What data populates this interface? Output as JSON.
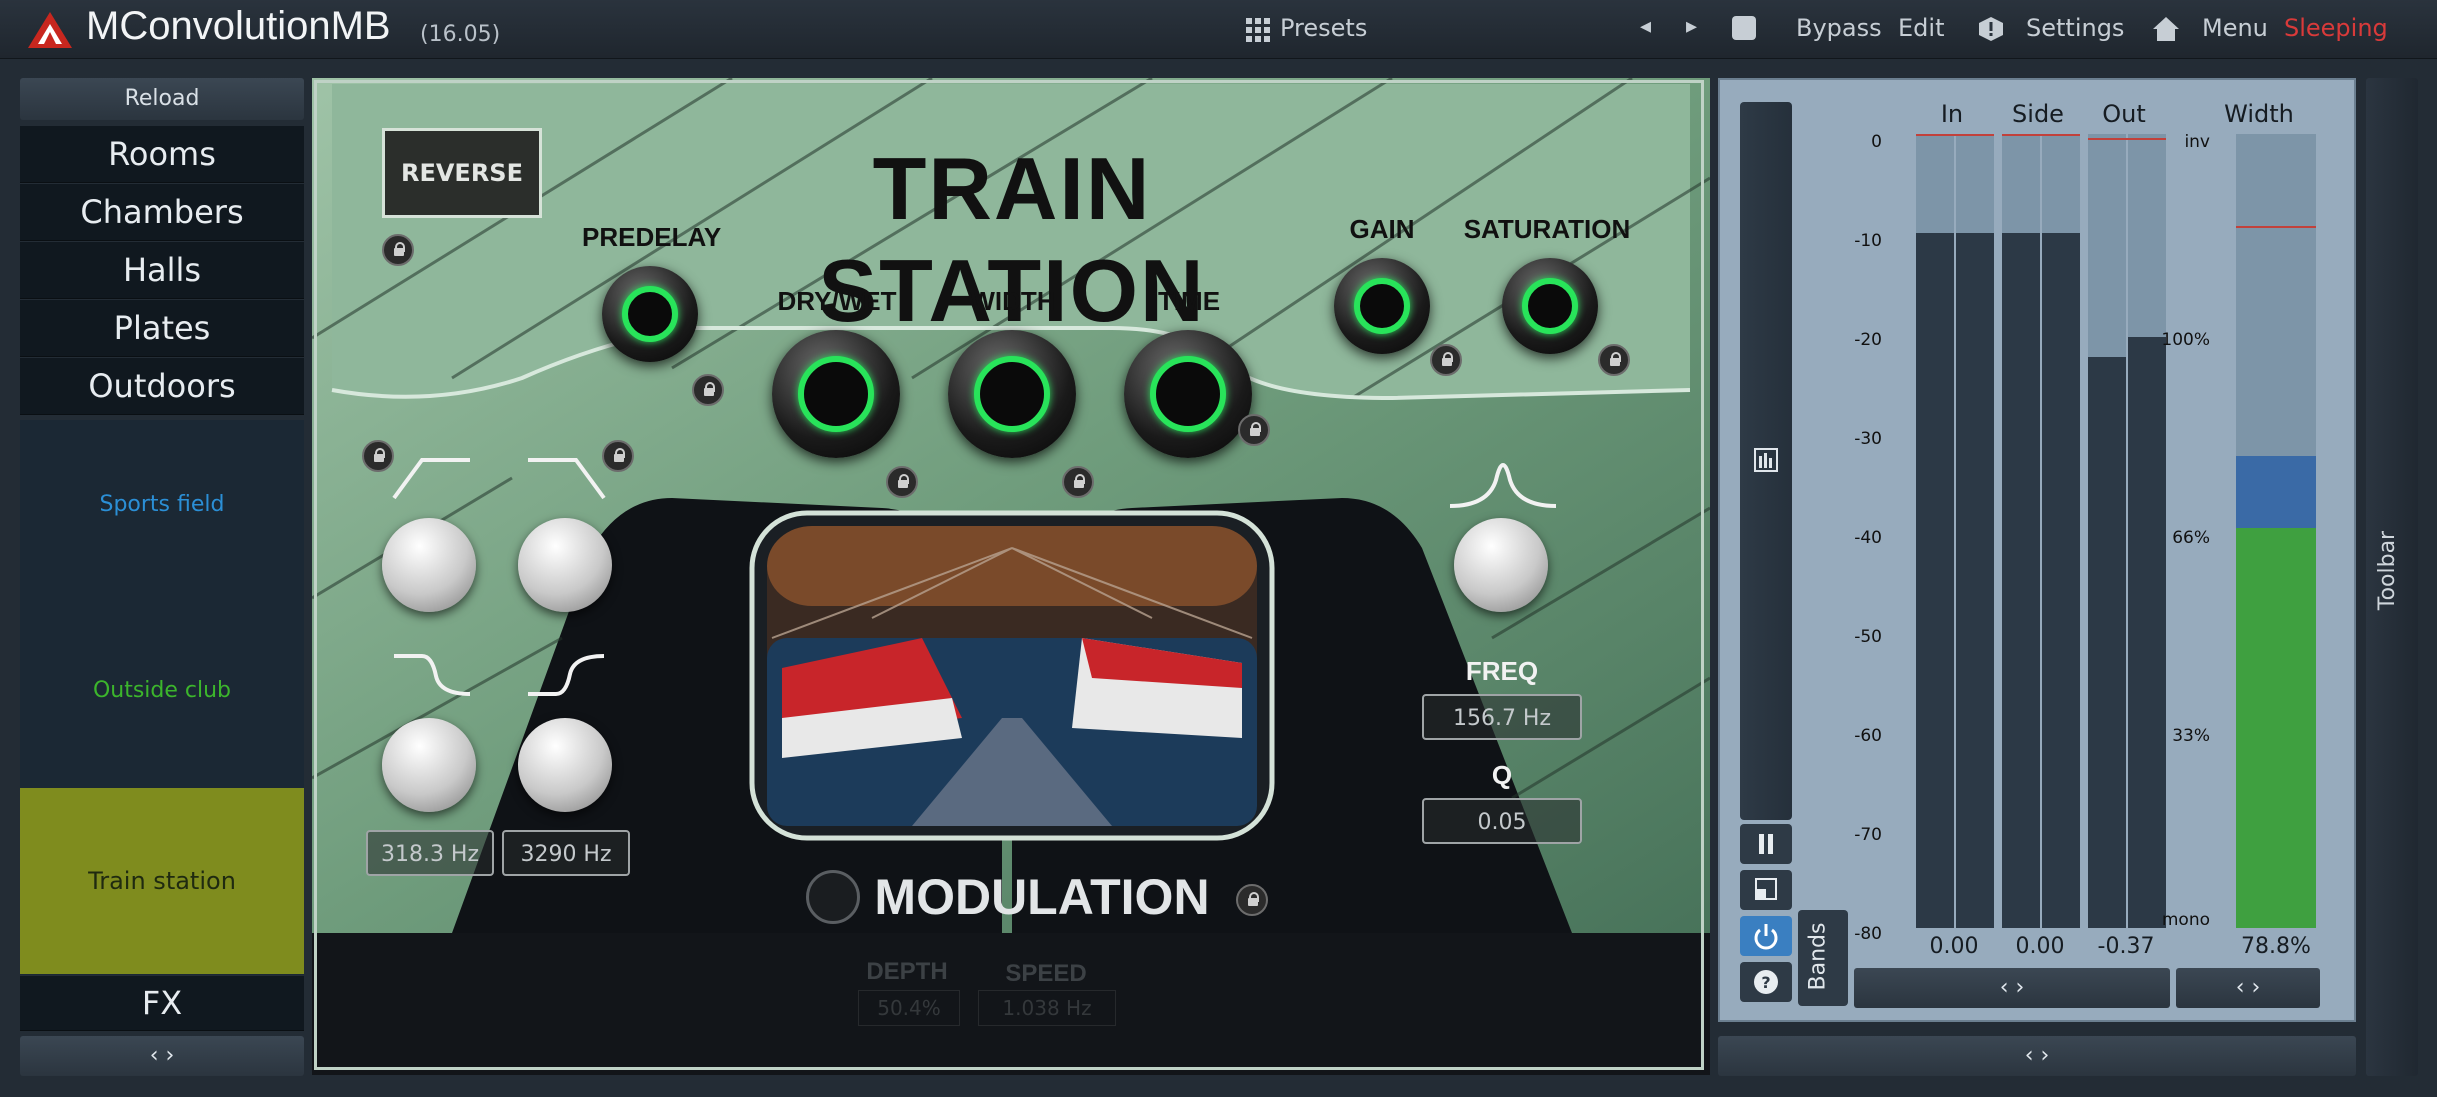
{
  "app": {
    "title": "MConvolutionMB",
    "version": "(16.05)"
  },
  "topbar": {
    "presets": "Presets",
    "prev": "◂",
    "next": "▸",
    "bypass": "Bypass",
    "edit": "Edit",
    "settings": "Settings",
    "menu": "Menu",
    "status": "Sleeping"
  },
  "left_panel": {
    "reload": "Reload",
    "categories": [
      "Rooms",
      "Chambers",
      "Halls",
      "Plates",
      "Outdoors"
    ],
    "presets": [
      "Sports field",
      "Outside club",
      "Train station"
    ],
    "fx": "FX",
    "arrows": "‹ ›"
  },
  "main": {
    "title": "TRAIN STATION",
    "reverse": "REVERSE",
    "knobs": {
      "predelay": "PREDELAY",
      "drywet": "DRY/WET",
      "width": "WIDTH",
      "time": "TIME",
      "gain": "GAIN",
      "saturation": "SATURATION"
    },
    "filters": {
      "low_value": "318.3 Hz",
      "high_value": "3290 Hz"
    },
    "bell": {
      "freq_label": "FREQ",
      "freq_value": "156.7 Hz",
      "q_label": "Q",
      "q_value": "0.05"
    },
    "modulation": {
      "title": "MODULATION",
      "depth_label": "DEPTH",
      "depth_value": "50.4%",
      "speed_label": "SPEED",
      "speed_value": "1.038 Hz"
    }
  },
  "meters": {
    "headers": {
      "in": "In",
      "side": "Side",
      "out": "Out",
      "width": "Width"
    },
    "scale": [
      "0",
      "-10",
      "-20",
      "-30",
      "-40",
      "-50",
      "-60",
      "-70",
      "-80"
    ],
    "width_scale": [
      "inv",
      "100%",
      "66%",
      "33%",
      "mono"
    ],
    "values": {
      "in": "0.00",
      "side": "0.00",
      "out": "-0.37",
      "width": "78.8%"
    },
    "bands": "Bands",
    "arrows": "‹ ›",
    "levels_db": {
      "in": [
        -10.2,
        -10.2
      ],
      "side": [
        -10.2,
        -10.2
      ],
      "out": [
        -22.5,
        -20.5
      ]
    }
  },
  "toolbar": {
    "label": "Toolbar"
  },
  "bottom": {
    "arrows": "‹ ›"
  },
  "colors": {
    "accent": "#28e45a",
    "status": "#d93a3a",
    "preset_selected": "#7f8c1e",
    "preset_sports": "#2b8fd6",
    "preset_club": "#3cb52c"
  }
}
